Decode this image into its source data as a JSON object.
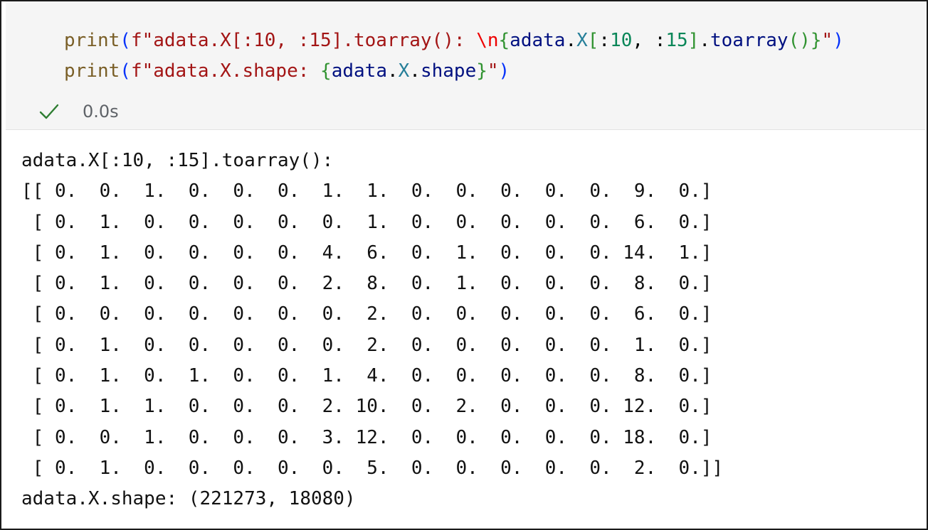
{
  "cell": {
    "line1": [
      {
        "t": "print",
        "c": "c-fn"
      },
      {
        "t": "(",
        "c": "c-p1"
      },
      {
        "t": "f\"adata.X[:10, :15].toarray(): ",
        "c": "c-str"
      },
      {
        "t": "\\n",
        "c": "c-esc"
      },
      {
        "t": "{",
        "c": "c-p2"
      },
      {
        "t": "adata",
        "c": "c-var"
      },
      {
        "t": ".",
        "c": "c-plain"
      },
      {
        "t": "X",
        "c": "c-cls"
      },
      {
        "t": "[",
        "c": "c-p2"
      },
      {
        "t": ":",
        "c": "c-plain"
      },
      {
        "t": "10",
        "c": "c-num"
      },
      {
        "t": ", :",
        "c": "c-plain"
      },
      {
        "t": "15",
        "c": "c-num"
      },
      {
        "t": "]",
        "c": "c-p2"
      },
      {
        "t": ".",
        "c": "c-plain"
      },
      {
        "t": "toarray",
        "c": "c-var"
      },
      {
        "t": "()",
        "c": "c-p2"
      },
      {
        "t": "}",
        "c": "c-p2"
      },
      {
        "t": "\"",
        "c": "c-str"
      },
      {
        "t": ")",
        "c": "c-p1"
      }
    ],
    "line2": [
      {
        "t": "print",
        "c": "c-fn"
      },
      {
        "t": "(",
        "c": "c-p1"
      },
      {
        "t": "f\"adata.X.shape: ",
        "c": "c-str"
      },
      {
        "t": "{",
        "c": "c-p2"
      },
      {
        "t": "adata",
        "c": "c-var"
      },
      {
        "t": ".",
        "c": "c-plain"
      },
      {
        "t": "X",
        "c": "c-cls"
      },
      {
        "t": ".",
        "c": "c-plain"
      },
      {
        "t": "shape",
        "c": "c-var"
      },
      {
        "t": "}",
        "c": "c-p2"
      },
      {
        "t": "\"",
        "c": "c-str"
      },
      {
        "t": ")",
        "c": "c-p1"
      }
    ]
  },
  "status": {
    "icon": "check-icon",
    "time": "0.0s",
    "success_color": "#2e7d32"
  },
  "output": {
    "lines": [
      "adata.X[:10, :15].toarray(): ",
      "[[ 0.  0.  1.  0.  0.  0.  1.  1.  0.  0.  0.  0.  0.  9.  0.]",
      " [ 0.  1.  0.  0.  0.  0.  0.  1.  0.  0.  0.  0.  0.  6.  0.]",
      " [ 0.  1.  0.  0.  0.  0.  4.  6.  0.  1.  0.  0.  0. 14.  1.]",
      " [ 0.  1.  0.  0.  0.  0.  2.  8.  0.  1.  0.  0.  0.  8.  0.]",
      " [ 0.  0.  0.  0.  0.  0.  0.  2.  0.  0.  0.  0.  0.  6.  0.]",
      " [ 0.  1.  0.  0.  0.  0.  0.  2.  0.  0.  0.  0.  0.  1.  0.]",
      " [ 0.  1.  0.  1.  0.  0.  1.  4.  0.  0.  0.  0.  0.  8.  0.]",
      " [ 0.  1.  1.  0.  0.  0.  2. 10.  0.  2.  0.  0.  0. 12.  0.]",
      " [ 0.  0.  1.  0.  0.  0.  3. 12.  0.  0.  0.  0.  0. 18.  0.]",
      " [ 0.  1.  0.  0.  0.  0.  0.  5.  0.  0.  0.  0.  0.  2.  0.]]",
      "adata.X.shape: (221273, 18080)"
    ]
  }
}
